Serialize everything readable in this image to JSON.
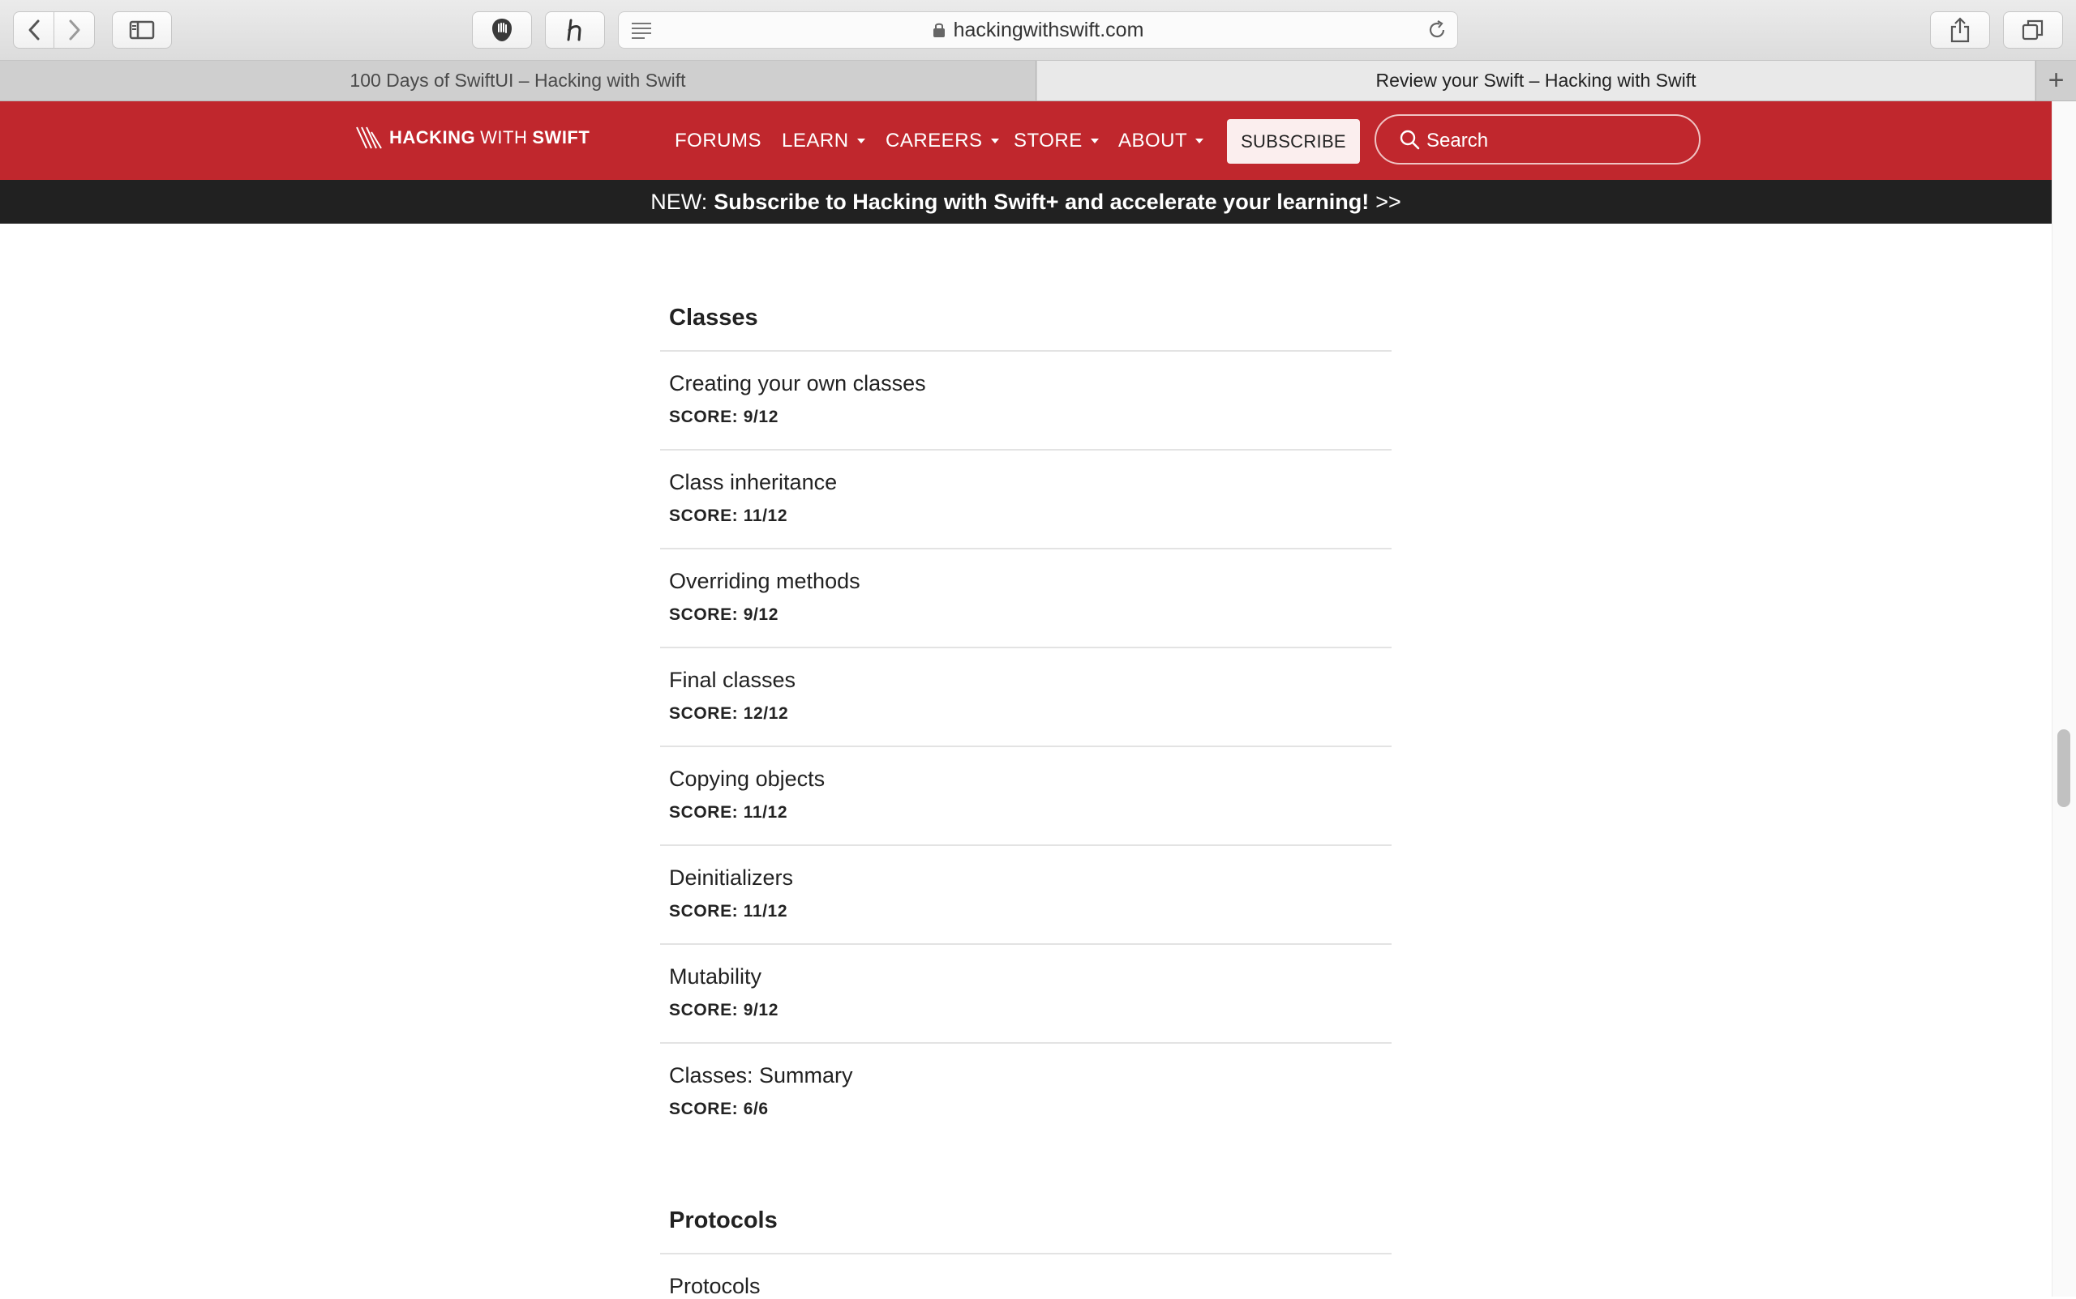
{
  "browser": {
    "url": "hackingwithswift.com",
    "tabs": [
      {
        "title": "100 Days of SwiftUI – Hacking with Swift",
        "active": false
      },
      {
        "title": "Review your Swift – Hacking with Swift",
        "active": true
      }
    ],
    "new_tab_label": "+"
  },
  "site": {
    "logo": {
      "part1": "HACKING",
      "part2": "WITH",
      "part3": "SWIFT"
    },
    "nav": [
      {
        "label": "FORUMS",
        "dropdown": false
      },
      {
        "label": "LEARN",
        "dropdown": true
      },
      {
        "label": "CAREERS",
        "dropdown": true
      },
      {
        "label": "STORE",
        "dropdown": true
      },
      {
        "label": "ABOUT",
        "dropdown": true
      }
    ],
    "subscribe_label": "SUBSCRIBE",
    "search_placeholder": "Search",
    "announcement": {
      "prefix": "NEW:",
      "message": "Subscribe to Hacking with Swift+ and accelerate your learning!",
      "suffix": ">>"
    }
  },
  "sections": [
    {
      "title": "Classes",
      "items": [
        {
          "name": "Creating your own classes",
          "score": "SCORE: 9/12"
        },
        {
          "name": "Class inheritance",
          "score": "SCORE: 11/12"
        },
        {
          "name": "Overriding methods",
          "score": "SCORE: 9/12"
        },
        {
          "name": "Final classes",
          "score": "SCORE: 12/12"
        },
        {
          "name": "Copying objects",
          "score": "SCORE: 11/12"
        },
        {
          "name": "Deinitializers",
          "score": "SCORE: 11/12"
        },
        {
          "name": "Mutability",
          "score": "SCORE: 9/12"
        },
        {
          "name": "Classes: Summary",
          "score": "SCORE: 6/6"
        }
      ]
    },
    {
      "title": "Protocols",
      "items": [
        {
          "name": "Protocols",
          "score": ""
        }
      ]
    }
  ],
  "colors": {
    "brand_red": "#c0272d",
    "announce_bg": "#212121"
  }
}
